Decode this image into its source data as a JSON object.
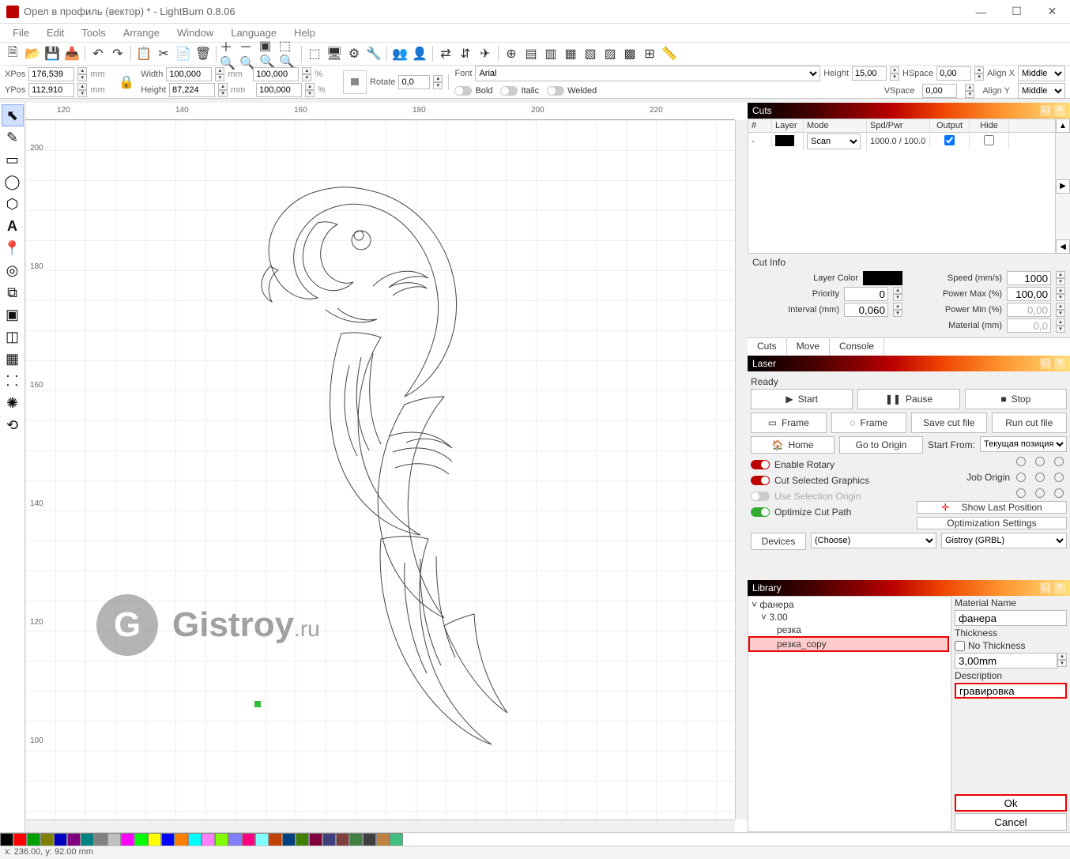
{
  "title": "Орел в профиль (вектор) * - LightBurn 0.8.06",
  "menu": [
    "File",
    "Edit",
    "Tools",
    "Arrange",
    "Window",
    "Language",
    "Help"
  ],
  "win_ctrl": {
    "min": "—",
    "max": "☐",
    "close": "✕"
  },
  "props": {
    "xpos_lbl": "XPos",
    "xpos": "176,539",
    "xunit": "mm",
    "ypos_lbl": "YPos",
    "ypos": "112,910",
    "yunit": "mm",
    "width_lbl": "Width",
    "width": "100,000",
    "wunit": "mm",
    "wpct": "100,000",
    "pct": "%",
    "height_lbl": "Height",
    "height": "87,224",
    "hunit": "mm",
    "hpct": "100,000",
    "rotate_lbl": "Rotate",
    "rotate": "0,0",
    "font_lbl": "Font",
    "font": "Arial",
    "fheight_lbl": "Height",
    "fheight": "15,00",
    "hspace_lbl": "HSpace",
    "hspace": "0,00",
    "vspace_lbl": "VSpace",
    "vspace": "0,00",
    "alignx_lbl": "Align X",
    "alignx": "Middle",
    "aligny_lbl": "Align Y",
    "aligny": "Middle",
    "bold": "Bold",
    "italic": "Italic",
    "welded": "Welded"
  },
  "ruler_h": [
    "120",
    "140",
    "160",
    "180",
    "200",
    "220"
  ],
  "ruler_v": [
    "200",
    "180",
    "160",
    "140",
    "120",
    "100"
  ],
  "watermark": {
    "logo": "G",
    "text": "Gistroy",
    "suffix": ".ru"
  },
  "cuts": {
    "title": "Cuts",
    "hdr": {
      "num": "#",
      "layer": "Layer",
      "mode": "Mode",
      "spd": "Spd/Pwr",
      "out": "Output",
      "hide": "Hide"
    },
    "rows": [
      {
        "num": "-",
        "mode": "Scan",
        "spd": "1000.0 / 100.0",
        "out": true,
        "hide": false
      }
    ]
  },
  "cut_info": {
    "title": "Cut Info",
    "layer_color": "Layer Color",
    "priority": "Priority",
    "priority_v": "0",
    "interval": "Interval (mm)",
    "interval_v": "0,060",
    "speed": "Speed  (mm/s)",
    "speed_v": "1000",
    "pmax": "Power Max (%)",
    "pmax_v": "100,00",
    "pmin": "Power Min (%)",
    "pmin_v": "0,00",
    "material": "Material (mm)",
    "material_v": "0,0"
  },
  "tabs": [
    "Cuts",
    "Move",
    "Console"
  ],
  "laser": {
    "title": "Laser",
    "ready": "Ready",
    "start": "Start",
    "pause": "Pause",
    "stop": "Stop",
    "frame1": "Frame",
    "frame2": "Frame",
    "save": "Save cut file",
    "run": "Run cut file",
    "home": "Home",
    "goto": "Go to Origin",
    "start_from": "Start From:",
    "start_from_v": "Текущая позиция",
    "job_origin": "Job Origin",
    "enable_rotary": "Enable Rotary",
    "cut_sel": "Cut Selected Graphics",
    "use_sel": "Use Selection Origin",
    "opt_path": "Optimize Cut Path",
    "show_last": "Show Last Position",
    "opt_settings": "Optimization Settings",
    "devices": "Devices",
    "choose": "(Choose)",
    "driver": "Gistroy (GRBL)"
  },
  "library": {
    "title": "Library",
    "tree": {
      "root": "фанера",
      "child": "3.00",
      "leaf1": "резка",
      "leaf2": "резка_copy"
    },
    "mat_name_lbl": "Material Name",
    "mat_name": "фанера",
    "thick_lbl": "Thickness",
    "no_thick": "No Thickness",
    "thick": "3,00mm",
    "desc_lbl": "Description",
    "desc": "гравировка",
    "ok": "Ok",
    "cancel": "Cancel"
  },
  "palette": [
    "#000",
    "#ff0000",
    "#00a000",
    "#808000",
    "#0000c0",
    "#800080",
    "#008080",
    "#808080",
    "#c0c0c0",
    "#ff00ff",
    "#00ff00",
    "#ffff00",
    "#0000ff",
    "#ff8000",
    "#00ffff",
    "#ff80ff",
    "#80ff00",
    "#8080ff",
    "#ff0080",
    "#80ffff",
    "#c04000",
    "#004080",
    "#408000",
    "#800040",
    "#404080",
    "#804040",
    "#408040",
    "#404040",
    "#c08040",
    "#40c080"
  ],
  "status": "x: 236.00, y: 92.00 mm"
}
